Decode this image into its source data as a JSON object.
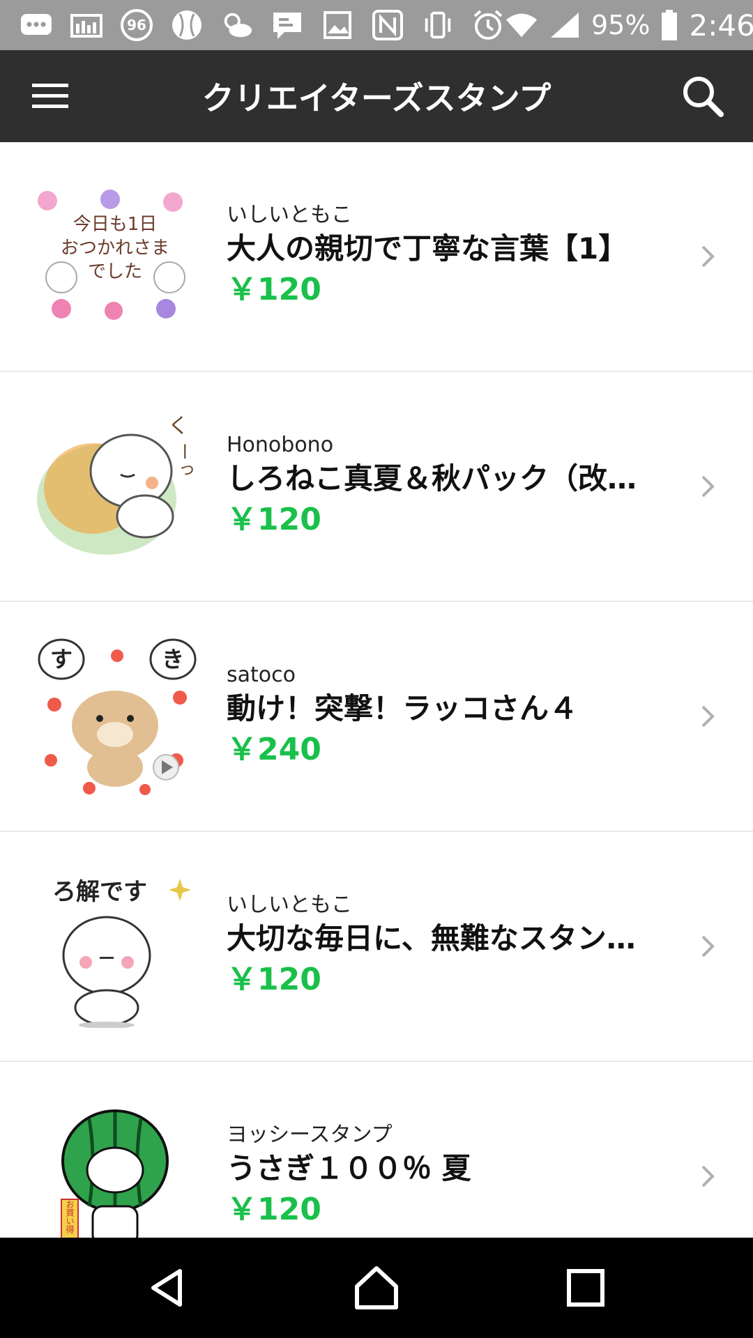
{
  "status_bar": {
    "battery_percent": "95%",
    "time": "2:46",
    "notification_badge": "96",
    "icons": [
      "message-icon",
      "gallery-icon",
      "badge-96-icon",
      "baseball-icon",
      "weather-icon",
      "chat-icon",
      "image-icon",
      "nfc-icon",
      "vibrate-icon",
      "alarm-icon",
      "wifi-icon",
      "signal-icon",
      "battery-icon"
    ]
  },
  "app_bar": {
    "title": "クリエイターズスタンプ",
    "menu_icon": "hamburger-menu-icon",
    "search_icon": "search-icon"
  },
  "stickers": [
    {
      "author": "いしいともこ",
      "title": "大人の親切で丁寧な言葉【1】",
      "price": "￥120",
      "thumb_text": [
        "今日も1日",
        "おつかれさま",
        "でした"
      ]
    },
    {
      "author": "Honobono",
      "title": "しろねこ真夏＆秋パック（改…",
      "price": "￥120",
      "thumb_text": [
        "く",
        "ーっ"
      ]
    },
    {
      "author": "satoco",
      "title": "動け！突撃！ラッコさん４",
      "price": "￥240",
      "thumb_text": [
        "す",
        "き"
      ]
    },
    {
      "author": "いしいともこ",
      "title": "大切な毎日に、無難なスタン…",
      "price": "￥120",
      "thumb_text": [
        "ろ解です"
      ]
    },
    {
      "author": "ヨッシースタンプ",
      "title": "うさぎ１００％ 夏",
      "price": "￥120",
      "thumb_text": [
        "お買い得"
      ]
    }
  ],
  "colors": {
    "status_bar": "#9b9b9b",
    "app_bar": "#2f2f2f",
    "price": "#19c04a",
    "nav_bar": "#000000"
  },
  "nav_bar": {
    "icons": [
      "back-icon",
      "home-icon",
      "recents-icon"
    ]
  }
}
